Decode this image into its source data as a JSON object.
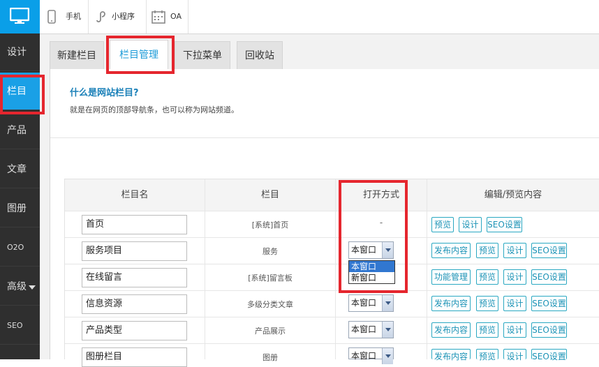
{
  "sidebar": {
    "logo_icon": "monitor-icon",
    "items": [
      {
        "label": "设计"
      },
      {
        "label": "栏目",
        "active": true
      },
      {
        "label": "产品"
      },
      {
        "label": "文章"
      },
      {
        "label": "图册"
      },
      {
        "label": "O2O"
      },
      {
        "label": "高级",
        "icon": "caret-down-icon"
      },
      {
        "label": "SEO"
      }
    ]
  },
  "topbar": {
    "items": [
      {
        "label": "手机",
        "icon": "phone-icon"
      },
      {
        "label": "小程序",
        "icon": "mini-program-icon"
      },
      {
        "label": "OA",
        "icon": "calendar-icon"
      }
    ]
  },
  "tabs": [
    {
      "label": "新建栏目"
    },
    {
      "label": "栏目管理",
      "active": true
    },
    {
      "label": "下拉菜单"
    },
    {
      "label": "回收站"
    }
  ],
  "help": {
    "title": "什么是网站栏目?",
    "desc": "就是在网页的顶部导航条，也可以称为网站频道。"
  },
  "table": {
    "headers": [
      "栏目名",
      "栏目",
      "打开方式",
      "编辑/预览内容"
    ],
    "rows": [
      {
        "name": "首页",
        "column": "[系统]首页",
        "open": "-",
        "actions": [
          "预览",
          "设计",
          "SEO设置"
        ]
      },
      {
        "name": "服务项目",
        "column": "服务",
        "open": "本窗口",
        "actions": [
          "发布内容",
          "预览",
          "设计",
          "SEO设置"
        ]
      },
      {
        "name": "在线留言",
        "column": "[系统]留言板",
        "open": "本窗口",
        "actions": [
          "功能管理",
          "预览",
          "设计",
          "SEO设置"
        ]
      },
      {
        "name": "信息资源",
        "column": "多级分类文章",
        "open": "本窗口",
        "actions": [
          "发布内容",
          "预览",
          "设计",
          "SEO设置"
        ]
      },
      {
        "name": "产品类型",
        "column": "产品展示",
        "open": "本窗口",
        "actions": [
          "发布内容",
          "预览",
          "设计",
          "SEO设置"
        ]
      },
      {
        "name": "图册栏目",
        "column": "图册",
        "open": "本窗口",
        "actions": [
          "发布内容",
          "预览",
          "设计",
          "SEO设置"
        ]
      }
    ]
  },
  "dropdown": {
    "options": [
      "本窗口",
      "新窗口"
    ],
    "highlighted": "本窗口"
  },
  "colors": {
    "sidebar_bg": "#2f2f2f",
    "accent": "#1aa0e6",
    "highlight_box": "#e5262e",
    "button_border": "#2aa8c2"
  }
}
